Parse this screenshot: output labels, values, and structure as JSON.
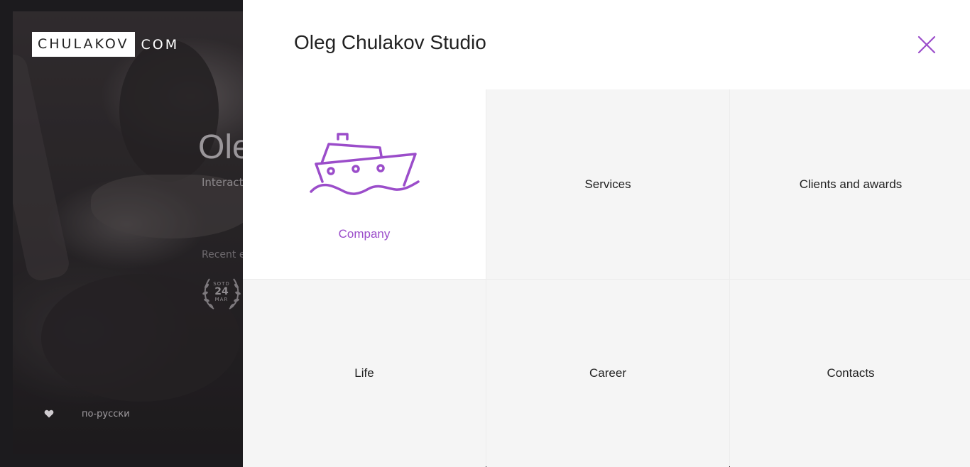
{
  "background": {
    "logo_box": "CHULAKOV",
    "logo_rest": "COM",
    "title": "Ole",
    "subtitle": "Interact",
    "recent": "Recent e",
    "award": {
      "top": "SOTD",
      "day": "24",
      "month": "MAR"
    },
    "heart_icon": "heart-icon",
    "language_link": "по-русски"
  },
  "menu": {
    "title": "Oleg Chulakov Studio",
    "close_icon": "close-icon",
    "accent_color": "#9b4dca",
    "items": [
      {
        "label": "Company",
        "icon": "ship-icon",
        "active": true
      },
      {
        "label": "Services"
      },
      {
        "label": "Clients and awards"
      },
      {
        "label": "Life"
      },
      {
        "label": "Career"
      },
      {
        "label": "Contacts"
      }
    ]
  }
}
